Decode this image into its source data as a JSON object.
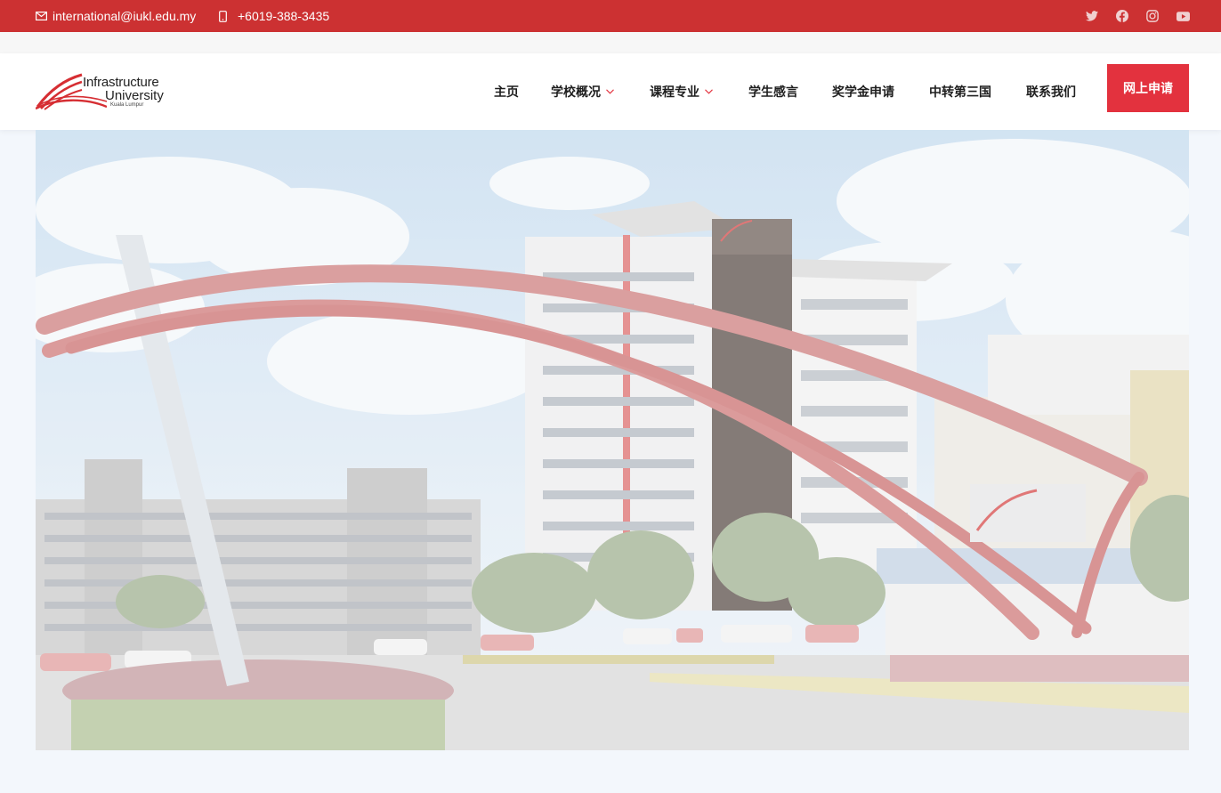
{
  "topbar": {
    "email": "international@iukl.edu.my",
    "phone": "+6019-388-3435",
    "social": [
      "twitter-icon",
      "facebook-icon",
      "instagram-icon",
      "youtube-icon"
    ],
    "background": "#cc3132"
  },
  "logo": {
    "line1": "Infrastructure",
    "line2": "University",
    "line3": "Kuala Lumpur"
  },
  "nav": {
    "home": "主页",
    "about": "学校概况",
    "programs": "课程专业",
    "testimonials": "学生感言",
    "scholarship": "奖学金申请",
    "transfer": "中转第三国",
    "contact": "联系我们"
  },
  "apply_button": "网上申请",
  "colors": {
    "accent": "#e3323e",
    "topbar": "#cc3132",
    "nav_text": "#1e1e1e"
  }
}
